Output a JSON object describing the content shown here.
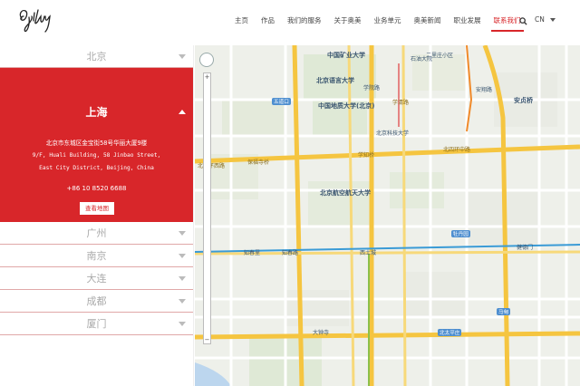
{
  "header": {
    "logo_text": "Ogilvy",
    "nav": [
      {
        "label": "主页"
      },
      {
        "label": "作品"
      },
      {
        "label": "我们的服务"
      },
      {
        "label": "关于奥美"
      },
      {
        "label": "业务单元"
      },
      {
        "label": "奥美新闻"
      },
      {
        "label": "职业发展"
      },
      {
        "label": "联系我们",
        "active": true
      }
    ],
    "lang": "CN",
    "accent": "#d8262a"
  },
  "offices": {
    "beijing": "北京",
    "shanghai": {
      "name": "上海",
      "address_cn": "北京市东城区金宝街58号华丽大厦9楼",
      "address_en_1": "9/F, Huali Building, 58 Jinbao Street,",
      "address_en_2": "East City District, Beijing, China",
      "phone": "+86 10 8520 6688",
      "map_button": "查看地图"
    },
    "others": [
      "广州",
      "南京",
      "大连",
      "成都",
      "厦门"
    ]
  },
  "map": {
    "labels": {
      "l1": "中国矿业大学",
      "l2": "北京语言大学",
      "l3": "五道口",
      "l4": "中国地质大学(北京)",
      "l5": "学院路",
      "l6": "北四环西路",
      "l7": "保福寺桥",
      "l8": "北四环中路",
      "l9": "北京航空航天大学",
      "l10": "知春里",
      "l11": "知春路",
      "l12": "西土城",
      "l13": "牡丹园",
      "l14": "健德门",
      "l15": "北太平庄",
      "l16": "大钟寺",
      "l17": "马甸",
      "l18": "安贞桥",
      "l19": "安翔路",
      "l20": "二里庄小区",
      "l21": "学清路",
      "l22": "石油大院",
      "l23": "学知桥",
      "l24": "北京科技大学"
    }
  }
}
